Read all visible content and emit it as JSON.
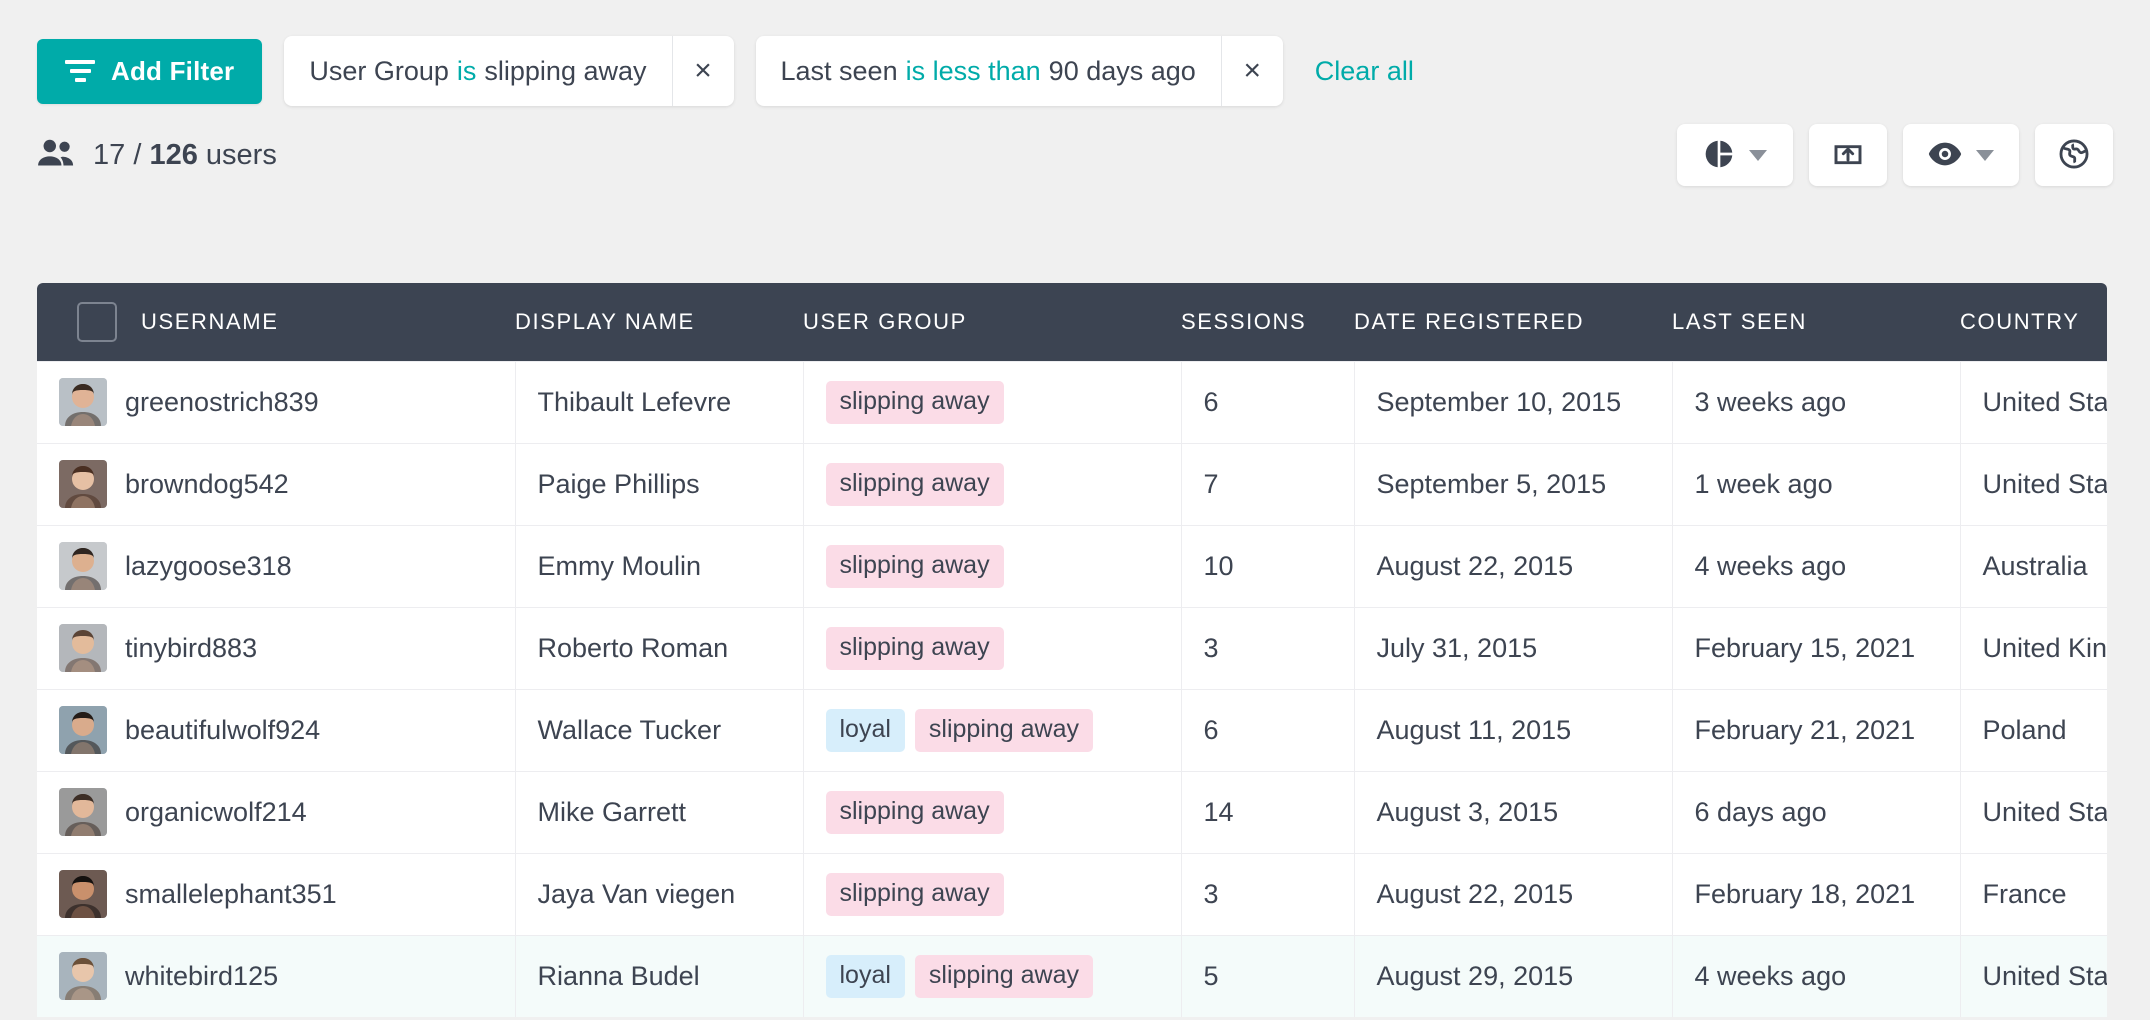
{
  "colors": {
    "accent": "#00ABA9",
    "header_bg": "#3c4452",
    "text": "#3d4451",
    "tag_pink": "#fbdce7",
    "tag_blue": "#d7eefb",
    "row_highlight": "#f4fbfa",
    "page_bg": "#f0f0f0"
  },
  "toolbar": {
    "add_filter_label": "Add Filter",
    "clear_all_label": "Clear all",
    "filters": [
      {
        "field": "User Group",
        "operator": "is",
        "value": "slipping away",
        "remove_label": "×"
      },
      {
        "field": "Last seen",
        "operator": "is less than",
        "value": "90 days ago",
        "remove_label": "×"
      }
    ]
  },
  "summary": {
    "icon": "users-icon",
    "shown": "17",
    "separator": "/",
    "total": "126",
    "unit": "users"
  },
  "actions": [
    {
      "name": "chart-view-button",
      "icon": "pie-chart-icon",
      "has_caret": true
    },
    {
      "name": "export-button",
      "icon": "export-icon",
      "has_caret": false
    },
    {
      "name": "visibility-button",
      "icon": "eye-icon",
      "has_caret": true
    },
    {
      "name": "globe-button",
      "icon": "globe-icon",
      "has_caret": false
    }
  ],
  "table": {
    "select_all": "select-all-checkbox",
    "columns": [
      "USERNAME",
      "DISPLAY NAME",
      "USER GROUP",
      "SESSIONS",
      "DATE REGISTERED",
      "LAST SEEN",
      "COUNTRY"
    ],
    "rows": [
      {
        "username": "greenostrich839",
        "display_name": "Thibault Lefevre",
        "groups": [
          {
            "label": "slipping away",
            "color": "pink"
          }
        ],
        "sessions": "6",
        "date_registered": "September 10, 2015",
        "last_seen": "3 weeks ago",
        "country": "United States",
        "highlighted": false
      },
      {
        "username": "browndog542",
        "display_name": "Paige Phillips",
        "groups": [
          {
            "label": "slipping away",
            "color": "pink"
          }
        ],
        "sessions": "7",
        "date_registered": "September 5, 2015",
        "last_seen": "1 week ago",
        "country": "United States",
        "highlighted": false
      },
      {
        "username": "lazygoose318",
        "display_name": "Emmy Moulin",
        "groups": [
          {
            "label": "slipping away",
            "color": "pink"
          }
        ],
        "sessions": "10",
        "date_registered": "August 22, 2015",
        "last_seen": "4 weeks ago",
        "country": "Australia",
        "highlighted": false
      },
      {
        "username": "tinybird883",
        "display_name": "Roberto Roman",
        "groups": [
          {
            "label": "slipping away",
            "color": "pink"
          }
        ],
        "sessions": "3",
        "date_registered": "July 31, 2015",
        "last_seen": "February 15, 2021",
        "country": "United Kingdom",
        "highlighted": false
      },
      {
        "username": "beautifulwolf924",
        "display_name": "Wallace Tucker",
        "groups": [
          {
            "label": "loyal",
            "color": "blue"
          },
          {
            "label": "slipping away",
            "color": "pink"
          }
        ],
        "sessions": "6",
        "date_registered": "August 11, 2015",
        "last_seen": "February 21, 2021",
        "country": "Poland",
        "highlighted": false
      },
      {
        "username": "organicwolf214",
        "display_name": "Mike Garrett",
        "groups": [
          {
            "label": "slipping away",
            "color": "pink"
          }
        ],
        "sessions": "14",
        "date_registered": "August 3, 2015",
        "last_seen": "6 days ago",
        "country": "United States",
        "highlighted": false
      },
      {
        "username": "smallelephant351",
        "display_name": "Jaya Van viegen",
        "groups": [
          {
            "label": "slipping away",
            "color": "pink"
          }
        ],
        "sessions": "3",
        "date_registered": "August 22, 2015",
        "last_seen": "February 18, 2021",
        "country": "France",
        "highlighted": false
      },
      {
        "username": "whitebird125",
        "display_name": "Rianna Budel",
        "groups": [
          {
            "label": "loyal",
            "color": "blue"
          },
          {
            "label": "slipping away",
            "color": "pink"
          }
        ],
        "sessions": "5",
        "date_registered": "August 29, 2015",
        "last_seen": "4 weeks ago",
        "country": "United States",
        "highlighted": true
      }
    ]
  }
}
